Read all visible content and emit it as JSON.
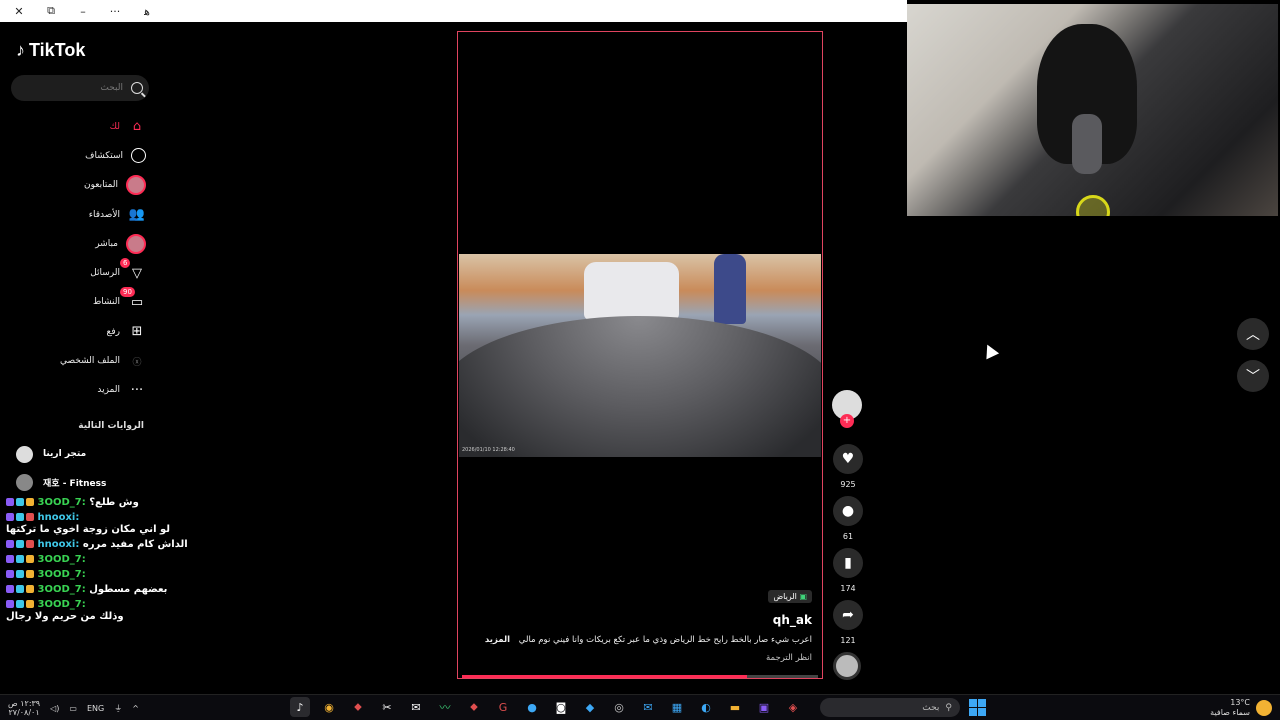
{
  "titlebar": {
    "buttons": [
      "✕",
      "⧉",
      "–",
      "···",
      "ﻫ"
    ]
  },
  "sidebar": {
    "logo": "TikTok",
    "search_placeholder": "البحث",
    "nav": [
      {
        "label": "لك",
        "icon": "home-icon",
        "active": true
      },
      {
        "label": "استكشاف",
        "icon": "compass-icon"
      },
      {
        "label": "المتابعون",
        "icon": "following-avatar-icon"
      },
      {
        "label": "الأصدقاء",
        "icon": "friends-icon"
      },
      {
        "label": "مباشر",
        "icon": "live-avatar-icon"
      },
      {
        "label": "الرسائل",
        "icon": "messages-icon",
        "badge": "6"
      },
      {
        "label": "النشاط",
        "icon": "activity-icon",
        "badge": "90"
      },
      {
        "label": "رفع",
        "icon": "upload-icon"
      },
      {
        "label": "الملف الشخصي",
        "icon": "profile-icon"
      },
      {
        "label": "المزيد",
        "icon": "more-icon"
      }
    ],
    "section_title": "الروايات التالية",
    "following": [
      {
        "name": "متجر ارينا"
      },
      {
        "name": "재호 - Fitness"
      }
    ]
  },
  "chat": [
    {
      "user": "3OOD_7:",
      "message": "وش طلع؟",
      "user_color": "#39d353"
    },
    {
      "user": "hnooxi:",
      "message": "لو اني مكان زوجة اخوي ما تركتها",
      "user_color": "#3fc8e8"
    },
    {
      "user": "hnooxi:",
      "message": "الداش كام مفيد مرره",
      "user_color": "#3fc8e8"
    },
    {
      "user": "3OOD_7:",
      "message": "",
      "user_color": "#39d353"
    },
    {
      "user": "3OOD_7:",
      "message": "",
      "user_color": "#39d353"
    },
    {
      "user": "3OOD_7:",
      "message": "بعضهم مسطول",
      "user_color": "#39d353"
    },
    {
      "user": "3OOD_7:",
      "message": "وذلك من حريم ولا رجال",
      "user_color": "#39d353"
    }
  ],
  "video": {
    "timestamp_overlay": "2026/01/10 12:28:40",
    "location": "الرياض",
    "author": "qh_ak",
    "caption": "اعرب شيء صار بالخط رايح خط الرياض وذي ما عبر تكع بريكات وانا فيني نوم مالي",
    "more_label": "المزيد",
    "translate_label": "انظر الترجمة",
    "progress": 0.8
  },
  "actions": {
    "likes": "925",
    "comments": "61",
    "saves": "174",
    "shares": "121"
  },
  "taskbar": {
    "language": "ENG",
    "time": "١٢:٣٩ ص",
    "date": "٢٧/٠٨/٠١",
    "search_placeholder": "بحث",
    "temperature": "13°C",
    "weather_text": "سماء صافية"
  },
  "colors": {
    "accent": "#fe2c55",
    "border": "#e0445f"
  }
}
